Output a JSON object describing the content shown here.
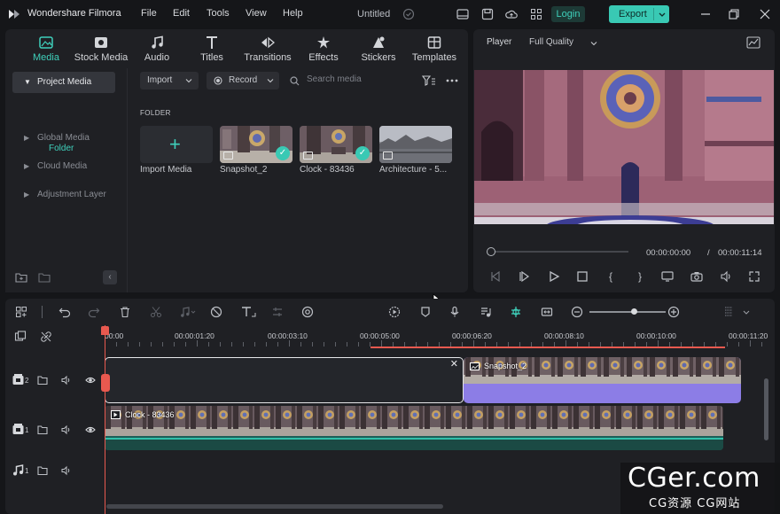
{
  "app": {
    "name": "Wondershare Filmora",
    "doc_title": "Untitled"
  },
  "menu": [
    "File",
    "Edit",
    "Tools",
    "View",
    "Help"
  ],
  "titlebar": {
    "login_label": "Login",
    "export_label": "Export"
  },
  "tabs": [
    {
      "label": "Media",
      "icon": "media-icon",
      "active": true
    },
    {
      "label": "Stock Media",
      "icon": "stock-media-icon"
    },
    {
      "label": "Audio",
      "icon": "music-note-icon"
    },
    {
      "label": "Titles",
      "icon": "titles-icon"
    },
    {
      "label": "Transitions",
      "icon": "transitions-icon"
    },
    {
      "label": "Effects",
      "icon": "effects-icon"
    },
    {
      "label": "Stickers",
      "icon": "stickers-icon"
    },
    {
      "label": "Templates",
      "icon": "templates-icon"
    }
  ],
  "sidebar": {
    "items": [
      "Project Media",
      "Global Media",
      "Cloud Media",
      "Adjustment Layer"
    ],
    "sub_item": "Folder"
  },
  "media_toolbar": {
    "import_label": "Import",
    "record_label": "Record",
    "search_placeholder": "Search media"
  },
  "folder": {
    "label": "FOLDER",
    "items": [
      {
        "name": "Import Media",
        "kind": "import"
      },
      {
        "name": "Snapshot_2",
        "kind": "image",
        "checked": true
      },
      {
        "name": "Clock - 83436",
        "kind": "video",
        "checked": true
      },
      {
        "name": "Architecture - 5...",
        "kind": "video",
        "checked": false
      }
    ]
  },
  "player": {
    "label": "Player",
    "quality": "Full Quality",
    "time_current": "00:00:00:00",
    "time_separator": "/",
    "time_total": "00:00:11:14"
  },
  "ruler": {
    "labels": [
      "00:00",
      "00:00:01:20",
      "00:00:03:10",
      "00:00:05:00",
      "00:00:06:20",
      "00:00:08:10",
      "00:00:10:00",
      "00:00:11:20"
    ]
  },
  "tracks": [
    {
      "number": "2",
      "type": "video"
    },
    {
      "number": "1",
      "type": "video"
    },
    {
      "number": "1",
      "type": "audio"
    }
  ],
  "clips": {
    "snapshot": "Snapshot_2",
    "clock": "Clock - 83436"
  },
  "watermark": {
    "big": "CGer.com",
    "small": "CG资源 CG网站"
  },
  "colors": {
    "accent": "#39c9b4",
    "playhead": "#e8594f",
    "image_clip": "#8c7de6",
    "video_clip": "#1b5e57"
  }
}
